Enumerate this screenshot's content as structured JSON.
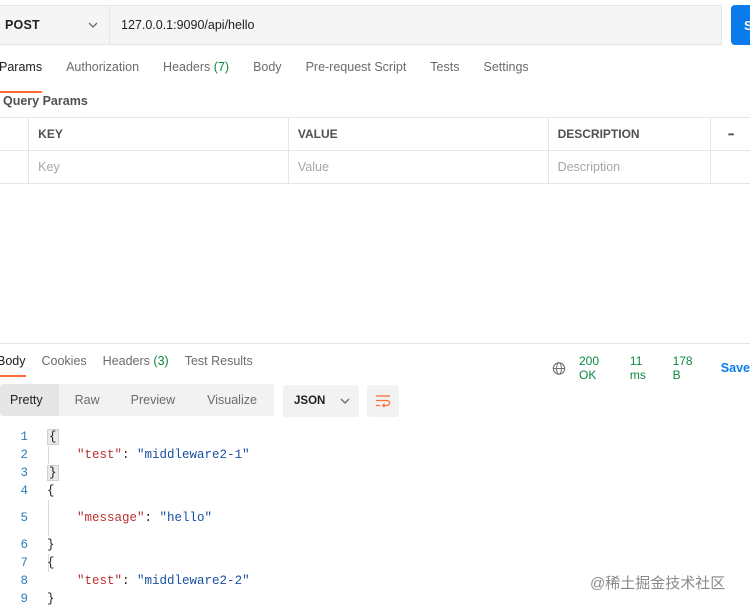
{
  "request": {
    "method": "POST",
    "url": "127.0.0.1:9090/api/hello",
    "send_label": "S"
  },
  "request_tabs": [
    {
      "label": "Params",
      "count": ""
    },
    {
      "label": "Authorization",
      "count": ""
    },
    {
      "label": "Headers ",
      "count": "(7)"
    },
    {
      "label": "Body",
      "count": ""
    },
    {
      "label": "Pre-request Script",
      "count": ""
    },
    {
      "label": "Tests",
      "count": ""
    },
    {
      "label": "Settings",
      "count": ""
    }
  ],
  "query_params": {
    "title": "Query Params",
    "columns": [
      "KEY",
      "VALUE",
      "DESCRIPTION"
    ],
    "more_label": "•••",
    "placeholders": {
      "key": "Key",
      "value": "Value",
      "description": "Description"
    }
  },
  "response": {
    "tabs": [
      {
        "label": "Body",
        "count": ""
      },
      {
        "label": "Cookies",
        "count": ""
      },
      {
        "label": "Headers ",
        "count": "(3)"
      },
      {
        "label": "Test Results",
        "count": ""
      }
    ],
    "status": "200 OK",
    "time": "11 ms",
    "size": "178 B",
    "save_label": "Save",
    "view_modes": [
      "Pretty",
      "Raw",
      "Preview",
      "Visualize"
    ],
    "format": "JSON",
    "lines": [
      {
        "num": "1",
        "text": "{"
      },
      {
        "num": "2",
        "key": "\"test\"",
        "value": "\"middleware2-1\""
      },
      {
        "num": "3",
        "text": "}"
      },
      {
        "num": "4",
        "text": "{"
      },
      {
        "num": "5",
        "key": "\"message\"",
        "value": "\"hello\""
      },
      {
        "num": "6",
        "text": "}"
      },
      {
        "num": "7",
        "text": "{"
      },
      {
        "num": "8",
        "key": "\"test\"",
        "value": "\"middleware2-2\""
      },
      {
        "num": "9",
        "text": "}"
      }
    ]
  },
  "watermark": "@稀土掘金技术社区",
  "colors": {
    "accent": "#ff6c37",
    "primary": "#097bed",
    "success": "#0a8a3f"
  }
}
